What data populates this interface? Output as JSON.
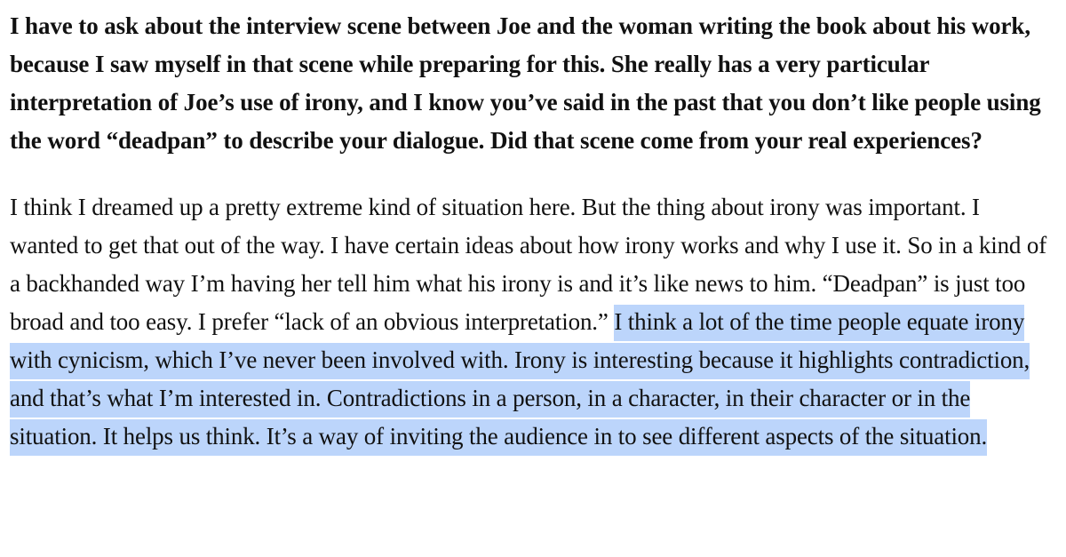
{
  "article": {
    "question": "I have to ask about the interview scene between Joe and the woman writing the book about his work, because I saw myself in that scene while preparing for this. She really has a very particular interpretation of Joe’s use of irony, and I know you’ve said in the past that you don’t like people using the word “deadpan” to describe your dialogue. Did that scene come from your real experiences?",
    "answer_plain": "I think I dreamed up a pretty extreme kind of situation here. But the thing about irony was important. I wanted to get that out of the way. I have certain ideas about how irony works and why I use it. So in a kind of a backhanded way I’m having her tell him what his irony is and it’s like news to him. “Deadpan” is just too broad and too easy. I prefer “lack of an obvious interpretation.”",
    "answer_selected": "I think a lot of the time people equate irony with cynicism, which I’ve never been involved with. Irony is interesting because it highlights contradiction, and that’s what I’m interested in. Contradictions in a person, in a character, in their character or in the situation. It helps us think. It’s a way of inviting the audience in to see different aspects of the situation."
  },
  "colors": {
    "selection_highlight": "#bcd5fb",
    "text": "#111111",
    "background": "#ffffff"
  }
}
